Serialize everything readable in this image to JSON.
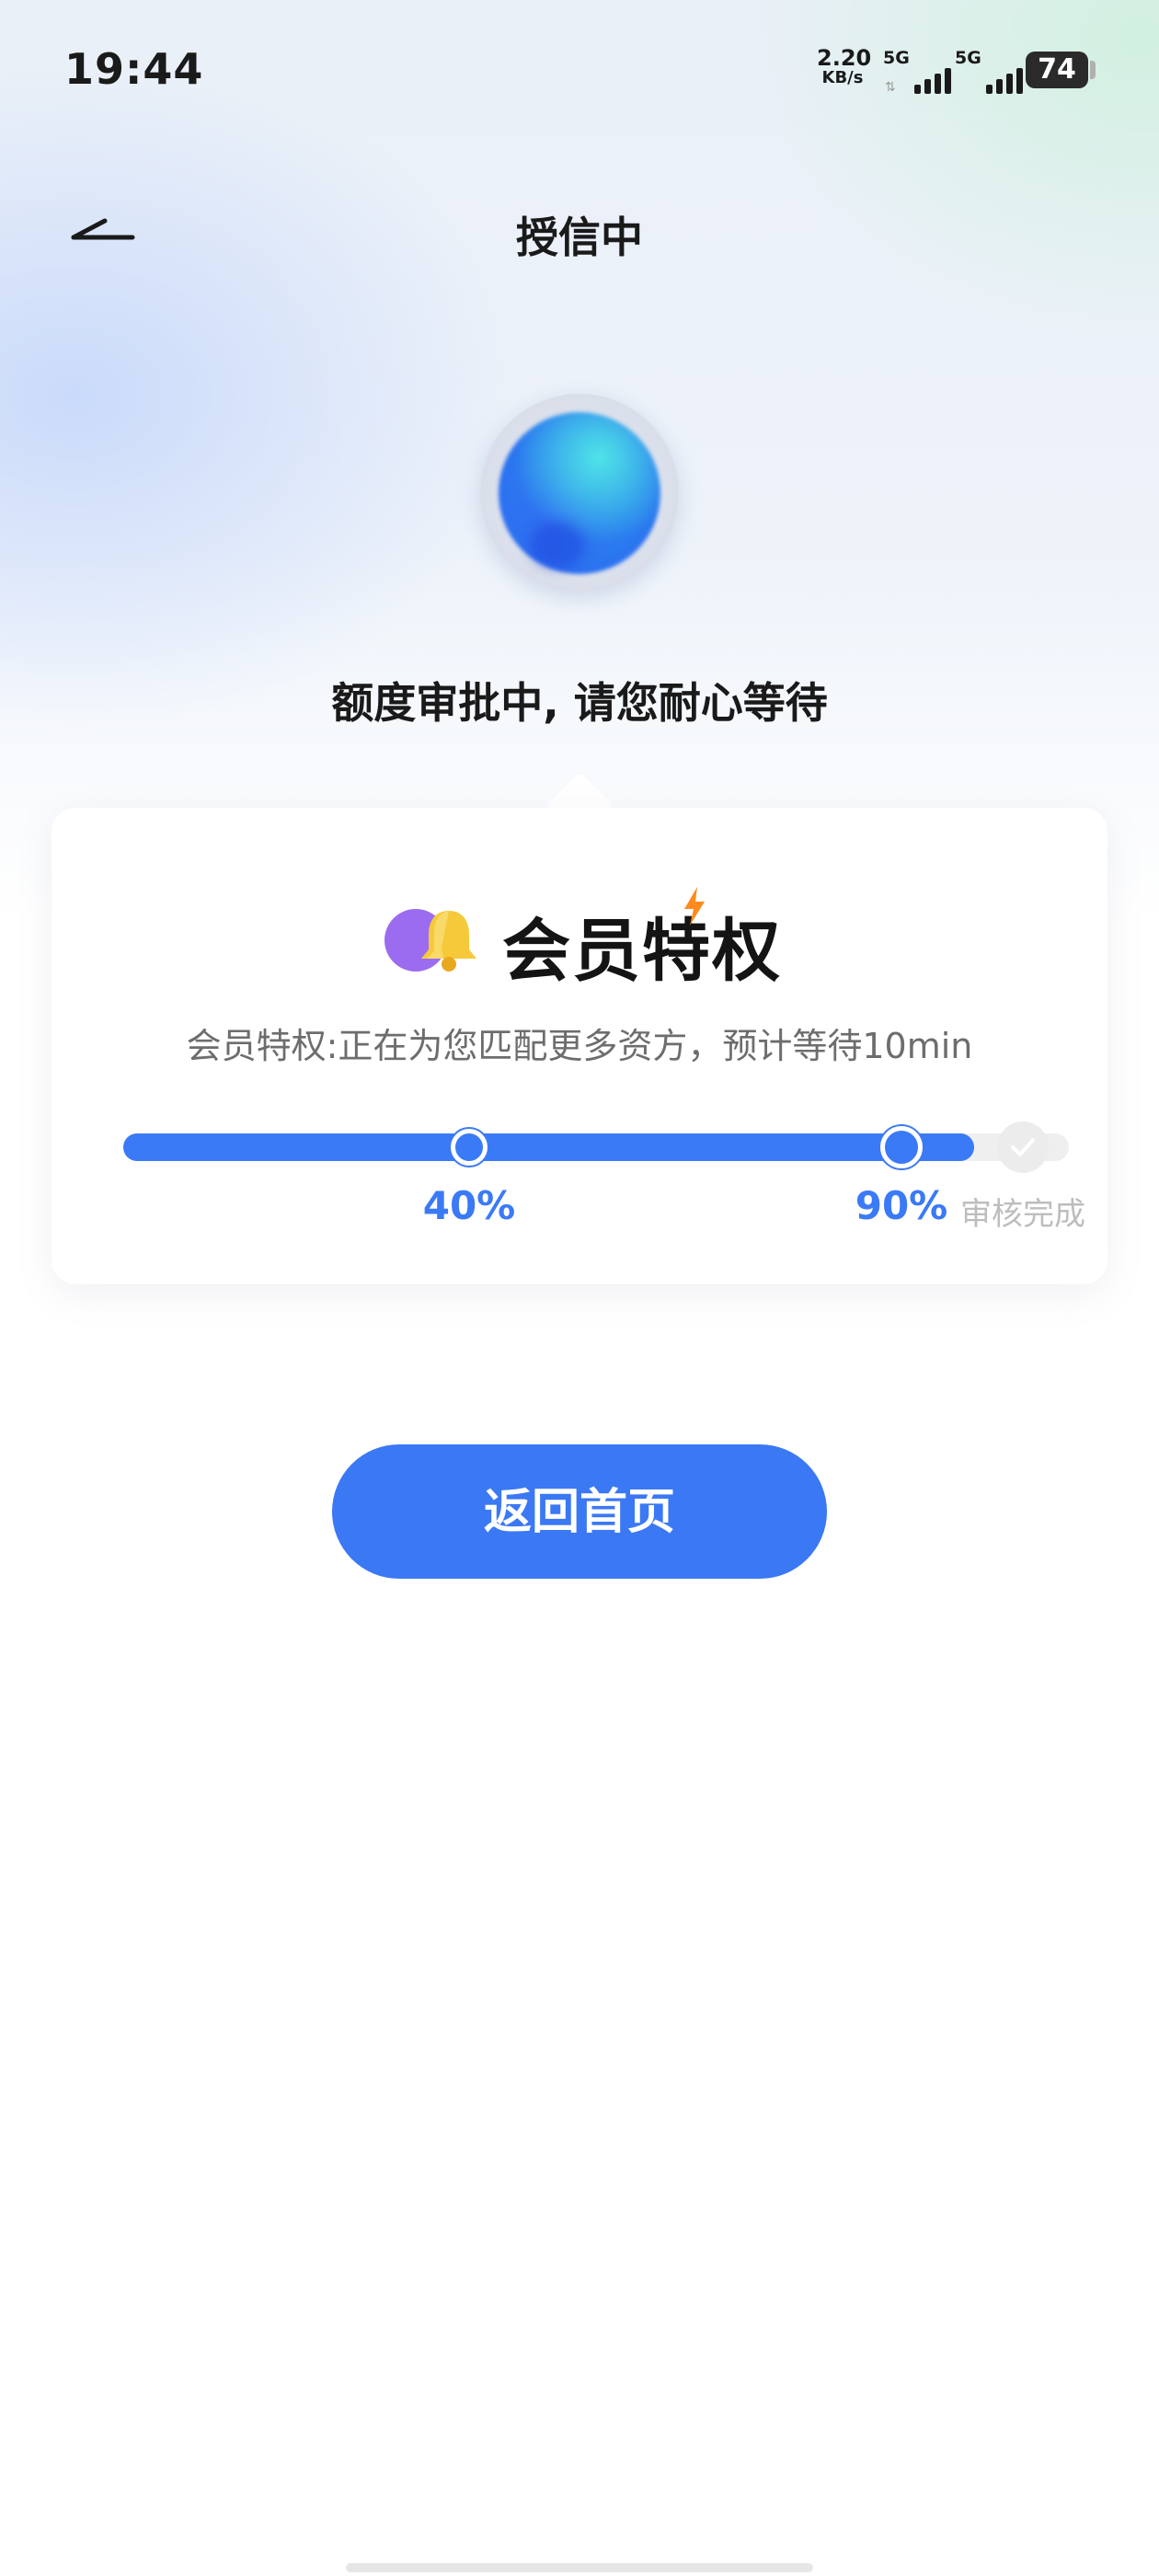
{
  "status_bar": {
    "time": "19:44",
    "net_speed_value": "2.20",
    "net_speed_unit": "KB/s",
    "signal_1_label": "5G",
    "signal_2_label": "5G",
    "battery": "74"
  },
  "header": {
    "title": "授信中"
  },
  "approval": {
    "status_text": "额度审批中, 请您耐心等待"
  },
  "member_card": {
    "title": "会员特权",
    "description": "会员特权:正在为您匹配更多资方，预计等待10min",
    "progress": {
      "current_fraction": 0.9,
      "steps": [
        {
          "label": "40%",
          "value": 0.4
        },
        {
          "label": "90%",
          "value": 0.9
        },
        {
          "label": "审核完成",
          "value": 1.0
        }
      ]
    }
  },
  "actions": {
    "home_button_label": "返回首页"
  },
  "colors": {
    "accent": "#3b7af6",
    "track": "#efefef",
    "text_primary": "#1a1a1a",
    "text_secondary": "#6d6d6d",
    "muted": "#bdbdbd"
  },
  "icons": {
    "back": "back-arrow-icon",
    "member": "bell-icon",
    "done": "check-icon"
  }
}
